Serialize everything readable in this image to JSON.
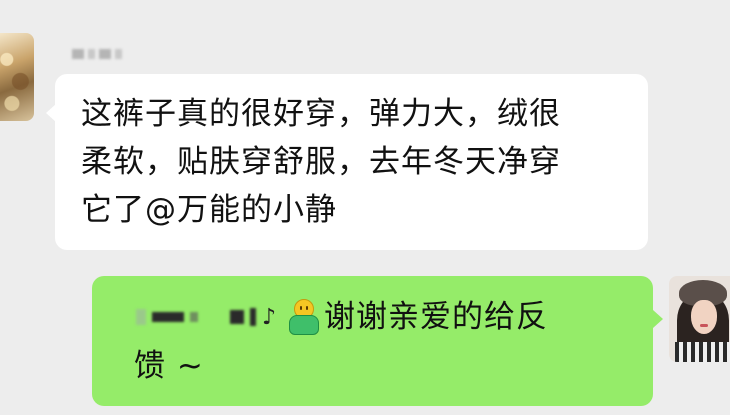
{
  "chat": {
    "incoming": {
      "text": "这裤子真的很好穿，弹力大，绒很\n柔软，贴肤穿舒服，去年冬天净穿\n它了@万能的小静"
    },
    "outgoing": {
      "line1": "谢谢亲爱的给反",
      "line2": "馈 ~"
    }
  },
  "colors": {
    "background": "#ededed",
    "incoming_bubble": "#ffffff",
    "outgoing_bubble": "#95ec69",
    "text": "#111111"
  },
  "icons": {
    "reply_emoji": "smiling-person-emoji-icon",
    "music": "music-note-icon"
  }
}
